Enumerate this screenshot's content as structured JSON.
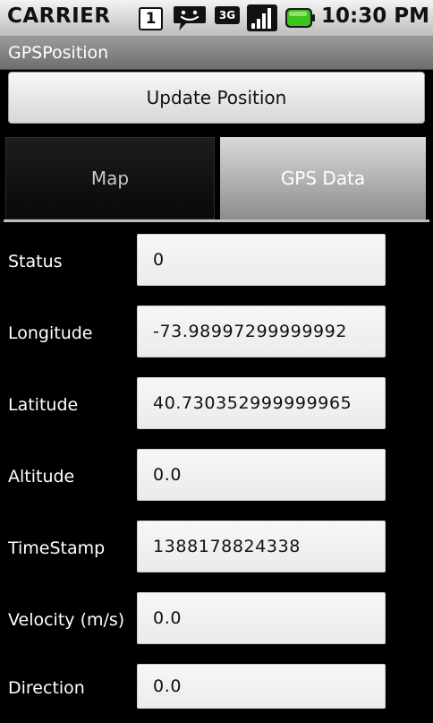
{
  "status_bar": {
    "carrier": "CARRIER",
    "sim_badge": "1",
    "network_type": "3G",
    "time": "10:30 PM"
  },
  "app": {
    "title": "GPSPosition"
  },
  "update_button": {
    "label": "Update Position"
  },
  "tabs": [
    {
      "label": "Map",
      "selected": false
    },
    {
      "label": "GPS Data",
      "selected": true
    }
  ],
  "fields": [
    {
      "label": "Status",
      "value": "0"
    },
    {
      "label": "Longitude",
      "value": "-73.98997299999992"
    },
    {
      "label": "Latitude",
      "value": "40.730352999999965"
    },
    {
      "label": "Altitude",
      "value": "0.0"
    },
    {
      "label": "TimeStamp",
      "value": "1388178824338"
    },
    {
      "label": "Velocity (m/s)",
      "value": "0.0"
    },
    {
      "label": "Direction",
      "value": "0.0"
    }
  ],
  "icons": {
    "sim": "sim-card-icon",
    "message": "message-notification-icon",
    "network": "3g-icon",
    "signal": "signal-strength-icon",
    "battery": "battery-icon"
  },
  "colors": {
    "status_bar": "#d0d0d0",
    "title_bar": "#808080",
    "background": "#000000",
    "battery_green": "#3fc21e"
  }
}
